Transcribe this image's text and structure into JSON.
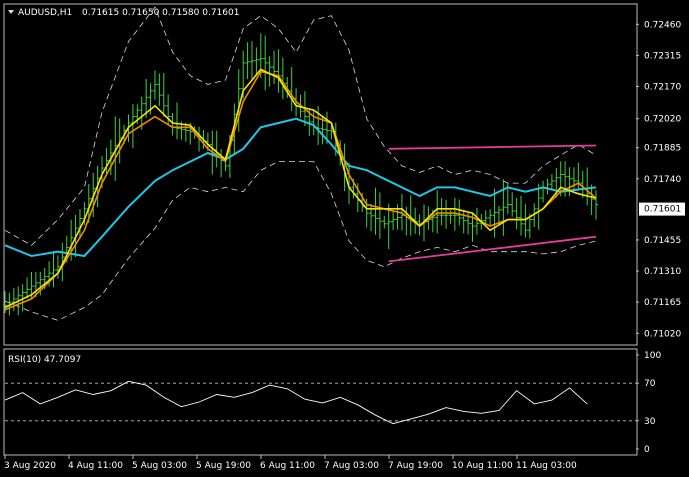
{
  "header": {
    "symbol_label": "AUDUSD,H1",
    "ohlc": "0.71615 0.71650 0.71580 0.71601"
  },
  "rsi_header": "RSI(10) 47.7097",
  "colors": {
    "background": "#000000",
    "frame": "#bdbdbd",
    "candles": "#3ed33e",
    "ma_fast": "#f5e400",
    "ma_mid": "#f08c00",
    "ma_slow": "#1ec8e6",
    "bands": "#ffffff",
    "trendline": "#e43c9a",
    "rsi_line": "#ffffff",
    "price_tag_bg": "#ffffff",
    "price_tag_text": "#000000"
  },
  "chart_data": [
    {
      "type": "line",
      "title": "AUDUSD,H1",
      "ylim": [
        0.7097,
        0.7255
      ],
      "y_ticks": [
        "0.72460",
        "0.72315",
        "0.72170",
        "0.72020",
        "0.71885",
        "0.71740",
        "0.71601",
        "0.71455",
        "0.71310",
        "0.71165",
        "0.71020"
      ],
      "current_price": "0.71601",
      "x_ticks": [
        "3 Aug 2020",
        "4 Aug 11:00",
        "5 Aug 03:00",
        "5 Aug 19:00",
        "6 Aug 11:00",
        "7 Aug 03:00",
        "7 Aug 19:00",
        "10 Aug 11:00",
        "11 Aug 03:00"
      ],
      "x_range_bars": [
        0,
        134
      ],
      "series": [
        {
          "role": "price",
          "x": [
            0,
            6,
            12,
            18,
            22,
            28,
            34,
            38,
            42,
            46,
            50,
            54,
            58,
            62,
            66,
            70,
            74,
            78,
            82,
            86,
            90,
            94,
            98,
            102,
            106,
            110,
            114,
            118,
            122,
            126,
            130,
            134
          ],
          "values": [
            0.7115,
            0.7124,
            0.7133,
            0.716,
            0.7179,
            0.72,
            0.7218,
            0.7198,
            0.7196,
            0.719,
            0.718,
            0.7228,
            0.723,
            0.7222,
            0.7208,
            0.7198,
            0.7196,
            0.717,
            0.7158,
            0.7153,
            0.7157,
            0.7153,
            0.7157,
            0.7157,
            0.7152,
            0.7157,
            0.7162,
            0.715,
            0.717,
            0.7176,
            0.7172,
            0.7162
          ]
        },
        {
          "role": "ma-fast",
          "x": [
            0,
            6,
            12,
            18,
            22,
            28,
            34,
            38,
            42,
            46,
            50,
            54,
            58,
            62,
            66,
            70,
            74,
            78,
            82,
            86,
            90,
            94,
            98,
            102,
            106,
            110,
            114,
            118,
            122,
            126,
            130,
            134
          ],
          "values": [
            0.7114,
            0.712,
            0.713,
            0.7155,
            0.7176,
            0.7198,
            0.7208,
            0.72,
            0.7199,
            0.719,
            0.7183,
            0.7215,
            0.7225,
            0.7221,
            0.7208,
            0.7206,
            0.72,
            0.717,
            0.716,
            0.716,
            0.716,
            0.7152,
            0.716,
            0.716,
            0.7158,
            0.715,
            0.7155,
            0.7155,
            0.716,
            0.717,
            0.7167,
            0.7165
          ]
        },
        {
          "role": "ma-mid",
          "x": [
            0,
            6,
            12,
            18,
            22,
            28,
            34,
            38,
            42,
            46,
            50,
            54,
            58,
            62,
            66,
            70,
            74,
            78,
            82,
            86,
            90,
            94,
            98,
            102,
            106,
            110,
            114,
            118,
            122,
            126,
            130,
            134
          ],
          "values": [
            0.7113,
            0.7118,
            0.713,
            0.715,
            0.7172,
            0.7195,
            0.7203,
            0.7198,
            0.7198,
            0.7188,
            0.7182,
            0.721,
            0.7224,
            0.7222,
            0.721,
            0.7203,
            0.72,
            0.7176,
            0.7162,
            0.716,
            0.7158,
            0.7152,
            0.7158,
            0.7158,
            0.7156,
            0.7152,
            0.7155,
            0.7155,
            0.716,
            0.7168,
            0.7172,
            0.7165
          ]
        },
        {
          "role": "ma-slow",
          "x": [
            0,
            6,
            12,
            18,
            22,
            28,
            34,
            38,
            42,
            46,
            50,
            54,
            58,
            62,
            66,
            70,
            74,
            78,
            82,
            86,
            90,
            94,
            98,
            102,
            106,
            110,
            114,
            118,
            122,
            126,
            130,
            134
          ],
          "values": [
            0.7143,
            0.7138,
            0.714,
            0.7138,
            0.7147,
            0.7161,
            0.7173,
            0.7178,
            0.7182,
            0.7186,
            0.7183,
            0.7188,
            0.7198,
            0.72,
            0.7202,
            0.7199,
            0.719,
            0.718,
            0.7178,
            0.7174,
            0.717,
            0.7166,
            0.717,
            0.717,
            0.7168,
            0.7166,
            0.717,
            0.7168,
            0.717,
            0.7168,
            0.7169,
            0.717
          ]
        },
        {
          "role": "band-upper",
          "x": [
            0,
            6,
            12,
            18,
            22,
            28,
            34,
            38,
            42,
            46,
            50,
            54,
            58,
            62,
            66,
            70,
            74,
            78,
            82,
            86,
            90,
            94,
            98,
            102,
            106,
            110,
            114,
            118,
            122,
            126,
            130,
            134
          ],
          "values": [
            0.715,
            0.7143,
            0.7155,
            0.717,
            0.7205,
            0.7238,
            0.7254,
            0.7233,
            0.7222,
            0.7218,
            0.722,
            0.7244,
            0.725,
            0.7244,
            0.7233,
            0.7248,
            0.725,
            0.7234,
            0.7202,
            0.7189,
            0.718,
            0.7177,
            0.718,
            0.7176,
            0.7178,
            0.7176,
            0.7172,
            0.7172,
            0.718,
            0.7185,
            0.719,
            0.7185
          ]
        },
        {
          "role": "band-lower",
          "x": [
            0,
            6,
            12,
            18,
            22,
            28,
            34,
            38,
            42,
            46,
            50,
            54,
            58,
            62,
            66,
            70,
            74,
            78,
            82,
            86,
            90,
            94,
            98,
            102,
            106,
            110,
            114,
            118,
            122,
            126,
            130,
            134
          ],
          "values": [
            0.7117,
            0.7112,
            0.7108,
            0.7114,
            0.712,
            0.7137,
            0.7151,
            0.7164,
            0.717,
            0.7168,
            0.717,
            0.7168,
            0.7178,
            0.7182,
            0.7182,
            0.7182,
            0.7167,
            0.7145,
            0.7136,
            0.7133,
            0.7137,
            0.714,
            0.7142,
            0.714,
            0.7143,
            0.714,
            0.714,
            0.714,
            0.7139,
            0.714,
            0.7143,
            0.7145
          ]
        },
        {
          "role": "trendline",
          "x": [
            87,
            134
          ],
          "values": [
            0.7188,
            0.71895
          ]
        },
        {
          "role": "trendline",
          "x": [
            87,
            134
          ],
          "values": [
            0.71355,
            0.7147
          ]
        }
      ]
    },
    {
      "type": "line",
      "title": "RSI(10) 47.7097",
      "ylim": [
        0,
        100
      ],
      "y_ticks": [
        "100",
        "70",
        "30",
        "0"
      ],
      "levels": [
        70,
        30
      ],
      "series": [
        {
          "role": "rsi",
          "x": [
            0,
            4,
            8,
            12,
            16,
            20,
            24,
            28,
            32,
            36,
            40,
            44,
            48,
            52,
            56,
            60,
            64,
            68,
            72,
            76,
            80,
            84,
            88,
            92,
            96,
            100,
            104,
            108,
            112,
            116,
            120,
            124,
            128,
            132
          ],
          "values": [
            52,
            60,
            48,
            55,
            63,
            58,
            62,
            72,
            68,
            55,
            45,
            50,
            58,
            55,
            60,
            68,
            64,
            53,
            49,
            55,
            47,
            36,
            27,
            32,
            37,
            44,
            40,
            38,
            41,
            62,
            48,
            52,
            65,
            48
          ]
        }
      ]
    }
  ]
}
